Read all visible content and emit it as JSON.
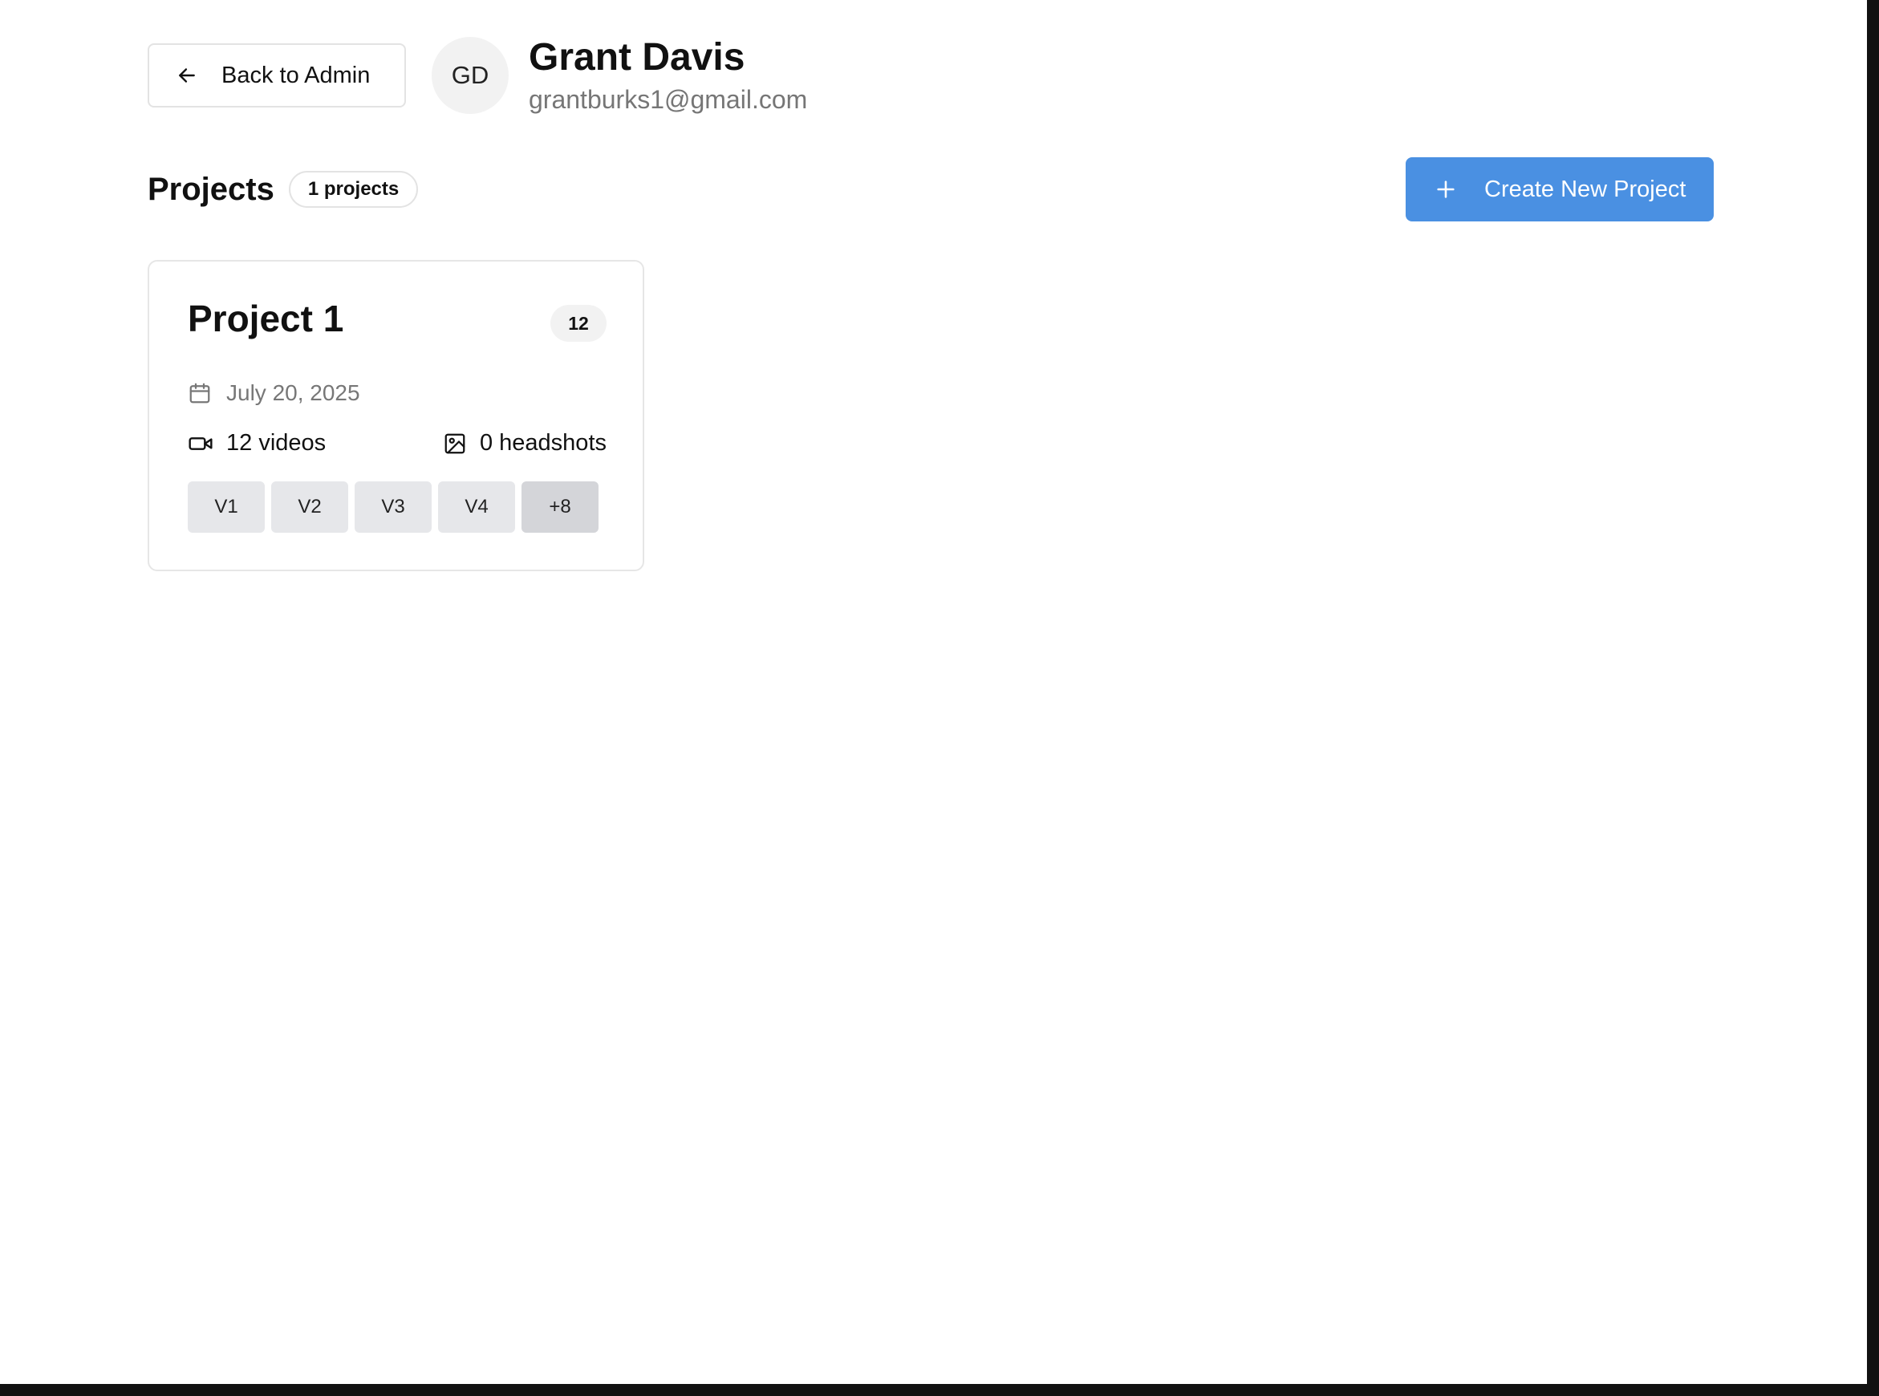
{
  "header": {
    "back_label": "Back to Admin",
    "avatar_initials": "GD",
    "user_name": "Grant Davis",
    "user_email": "grantburks1@gmail.com"
  },
  "projects_section": {
    "title": "Projects",
    "count_label": "1 projects",
    "create_label": "Create New Project"
  },
  "projects": [
    {
      "title": "Project 1",
      "badge": "12",
      "date": "July 20, 2025",
      "videos_label": "12 videos",
      "headshots_label": "0 headshots",
      "thumbnails": [
        "V1",
        "V2",
        "V3",
        "V4"
      ],
      "more_label": "+8"
    }
  ],
  "icons": {
    "back": "arrow-left-icon",
    "create": "plus-icon",
    "date": "calendar-icon",
    "videos": "video-camera-icon",
    "headshots": "image-icon"
  },
  "colors": {
    "accent": "#4a90e2",
    "muted_text": "#767676"
  }
}
